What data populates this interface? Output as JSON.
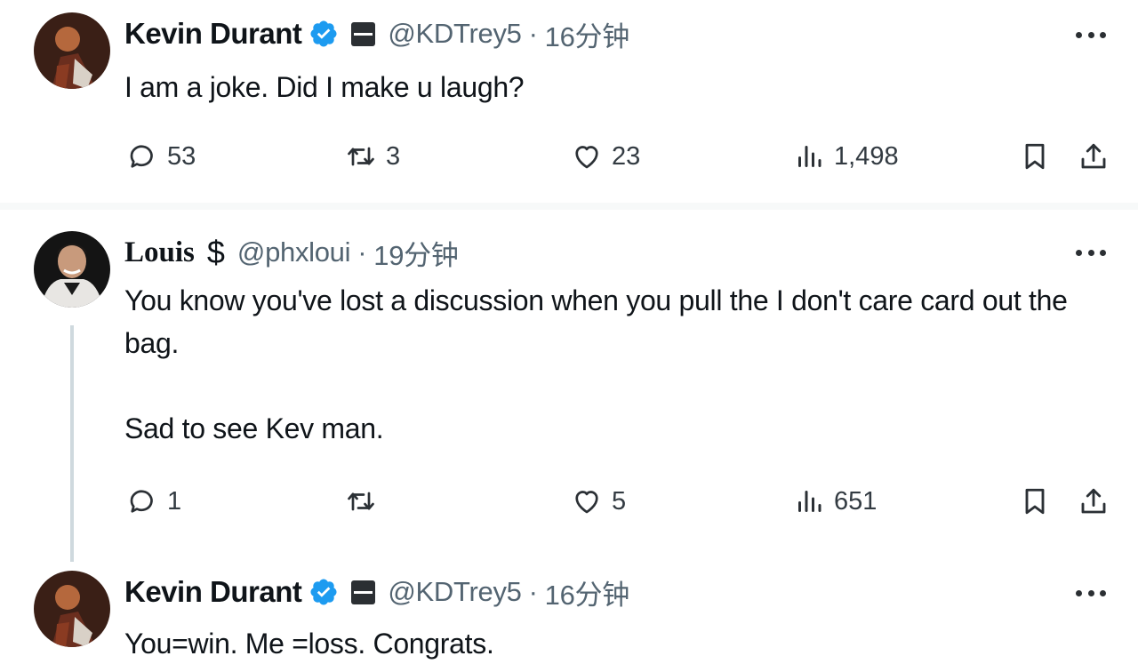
{
  "tweets": [
    {
      "name": "Kevin Durant",
      "verified": true,
      "handle": "@KDTrey5",
      "sep": "·",
      "time": "16分钟",
      "text_lines": [
        "I am a joke. Did I make u laugh?"
      ],
      "stats": {
        "replies": "53",
        "retweets": "3",
        "likes": "23",
        "views": "1,498"
      }
    },
    {
      "name": "Louis",
      "name_extra": "$",
      "handle": "@phxloui",
      "sep": "·",
      "time": "19分钟",
      "text_lines": [
        "You know you've lost a discussion when you pull the I don't care card out the",
        "bag.",
        "Sad to see Kev man."
      ],
      "stats": {
        "replies": "1",
        "retweets": "",
        "likes": "5",
        "views": "651"
      }
    },
    {
      "name": "Kevin Durant",
      "verified": true,
      "handle": "@KDTrey5",
      "sep": "·",
      "time": "16分钟",
      "text_lines": [
        "You=win. Me =loss. Congrats."
      ]
    }
  ],
  "colors": {
    "verified": "#1d9bf0",
    "muted": "#536471",
    "thread_line": "#cfd9de"
  },
  "icons": [
    "reply-icon",
    "retweet-icon",
    "like-icon",
    "views-icon",
    "bookmark-icon",
    "share-icon",
    "more-icon",
    "verified-icon",
    "flag-icon"
  ]
}
